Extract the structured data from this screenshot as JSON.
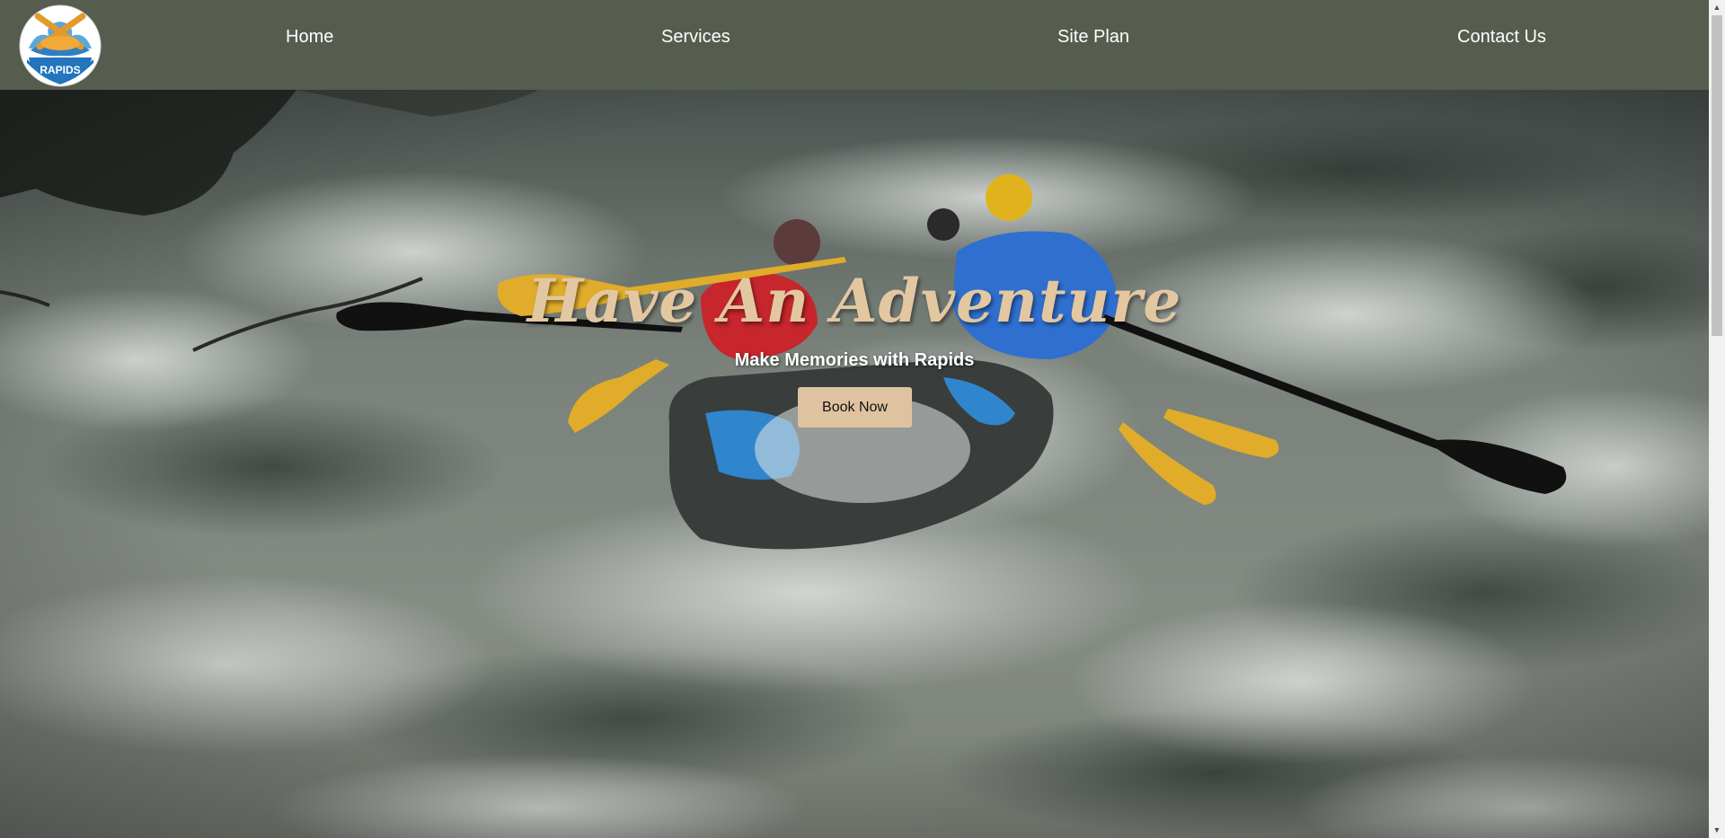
{
  "nav": {
    "logo_text": "RAPIDS",
    "items": [
      {
        "label": "Home"
      },
      {
        "label": "Services"
      },
      {
        "label": "Site Plan"
      },
      {
        "label": "Contact Us"
      }
    ]
  },
  "hero": {
    "title": "Have An Adventure",
    "subtitle": "Make Memories with Rapids",
    "cta_label": "Book Now"
  },
  "colors": {
    "nav_bg": "#565d4f",
    "title_color": "#e3c7a1",
    "button_bg": "#dfc3a0"
  }
}
